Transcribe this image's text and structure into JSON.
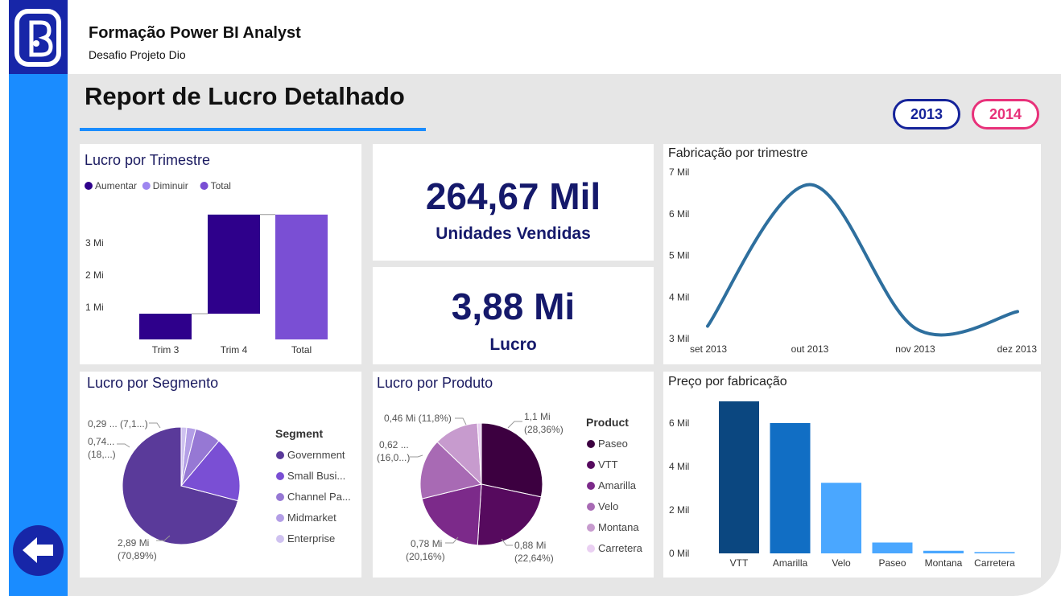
{
  "header": {
    "logo": "b-logo-icon",
    "title": "Formação Power BI Analyst",
    "subtitle": "Desafio Projeto Dio"
  },
  "report": {
    "title": "Report de Lucro Detalhado",
    "years": [
      "2013",
      "2014"
    ]
  },
  "colors": {
    "sidebar": "#1a8cff",
    "logo_bg": "#1726a8",
    "year_2013": "#15239a",
    "year_2014": "#e8317a",
    "kpi_text": "#15196b"
  },
  "kpis": [
    {
      "value": "264,67 Mil",
      "label": "Unidades Vendidas"
    },
    {
      "value": "3,88 Mi",
      "label": "Lucro"
    }
  ],
  "nav": {
    "back_icon": "arrow-left-icon"
  },
  "chart_data": [
    {
      "type": "bar",
      "subtype": "waterfall",
      "title": "Lucro por Trimestre",
      "legend": [
        "Aumentar",
        "Diminuir",
        "Total"
      ],
      "legend_colors": [
        "#2e008b",
        "#9e86f0",
        "#7a4fd4"
      ],
      "categories": [
        "Trim 3",
        "Trim 4",
        "Total"
      ],
      "steps": [
        {
          "category": "Trim 3",
          "kind": "Aumentar",
          "start": 0.0,
          "end": 0.8
        },
        {
          "category": "Trim 4",
          "kind": "Aumentar",
          "start": 0.8,
          "end": 3.88
        },
        {
          "category": "Total",
          "kind": "Total",
          "start": 0.0,
          "end": 3.88
        }
      ],
      "yticks": [
        1,
        2,
        3
      ],
      "ytick_labels": [
        "1 Mi",
        "2 Mi",
        "3 Mi"
      ],
      "ylim": [
        0,
        4.2
      ]
    },
    {
      "type": "line",
      "title": "Fabricação por trimestre",
      "x": [
        "set 2013",
        "out 2013",
        "nov 2013",
        "dez 2013"
      ],
      "values": [
        3.3,
        6.7,
        3.25,
        3.65
      ],
      "yticks": [
        3,
        4,
        5,
        6,
        7
      ],
      "ytick_labels": [
        "3 Mil",
        "4 Mil",
        "5 Mil",
        "6 Mil",
        "7 Mil"
      ],
      "ylim": [
        3,
        7
      ],
      "color": "#2e6f9e"
    },
    {
      "type": "pie",
      "title": "Lucro por Segmento",
      "legend_title": "Segment",
      "labels": [
        "Government",
        "Small Busi...",
        "Channel Pa...",
        "Midmarket",
        "Enterprise"
      ],
      "values": [
        70.89,
        18.0,
        7.1,
        2.5,
        1.51
      ],
      "colors": [
        "#5a3a9a",
        "#7a4fd4",
        "#9678d4",
        "#b39ee6",
        "#cfc2f0"
      ],
      "data_labels": [
        {
          "line1": "2,89 Mi",
          "line2": "(70,89%)"
        },
        {
          "line1": "0,74...",
          "line2": "(18,...)"
        },
        {
          "line1": "0,29 ... (7,1...)",
          "line2": ""
        }
      ]
    },
    {
      "type": "pie",
      "title": "Lucro por Produto",
      "legend_title": "Product",
      "labels": [
        "Paseo",
        "VTT",
        "Amarilla",
        "Velo",
        "Montana",
        "Carretera"
      ],
      "values": [
        28.36,
        22.64,
        20.16,
        16.0,
        11.8,
        1.04
      ],
      "colors": [
        "#3c0040",
        "#560a5e",
        "#7c2a8a",
        "#a86ab4",
        "#c79bce",
        "#ead0f2"
      ],
      "data_labels": [
        {
          "line1": "1,1 Mi",
          "line2": "(28,36%)"
        },
        {
          "line1": "0,88 Mi",
          "line2": "(22,64%)"
        },
        {
          "line1": "0,78 Mi",
          "line2": "(20,16%)"
        },
        {
          "line1": "0,62 ...",
          "line2": "(16,0...)"
        },
        {
          "line1": "0,46 Mi (11,8%)",
          "line2": ""
        }
      ]
    },
    {
      "type": "bar",
      "title": "Preço por fabricação",
      "categories": [
        "VTT",
        "Amarilla",
        "Velo",
        "Paseo",
        "Montana",
        "Carretera"
      ],
      "values": [
        7.0,
        6.0,
        3.25,
        0.5,
        0.12,
        0.06
      ],
      "colors": [
        "#0b4780",
        "#116ec4",
        "#4aa7ff",
        "#4aa7ff",
        "#4aa7ff",
        "#4aa7ff"
      ],
      "yticks": [
        0,
        2,
        4,
        6
      ],
      "ytick_labels": [
        "0 Mil",
        "2 Mil",
        "4 Mil",
        "6 Mil"
      ],
      "ylim": [
        0,
        7
      ]
    }
  ]
}
